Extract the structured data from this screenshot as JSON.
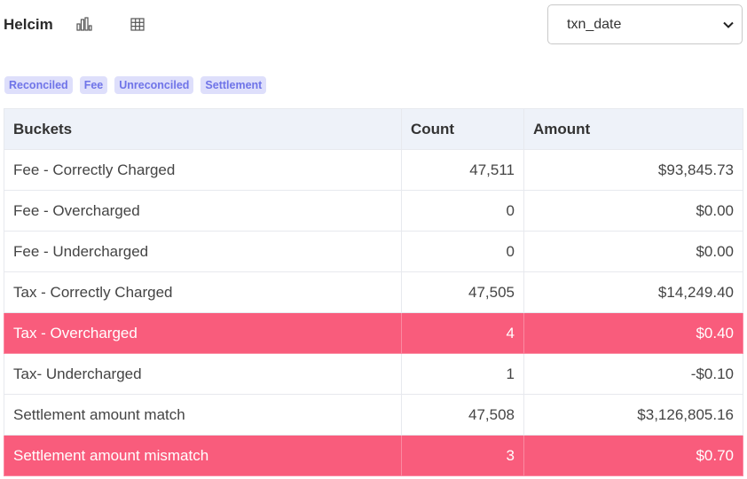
{
  "header": {
    "brand": "Helcim",
    "chart_icon": "bar-chart-icon",
    "table_icon": "table-grid-icon"
  },
  "date_select": {
    "value": "txn_date",
    "icon": "chevron-down-icon"
  },
  "tags": [
    {
      "label": "Reconciled"
    },
    {
      "label": "Fee"
    },
    {
      "label": "Unreconciled"
    },
    {
      "label": "Settlement"
    }
  ],
  "table": {
    "columns": [
      "Buckets",
      "Count",
      "Amount"
    ],
    "rows": [
      {
        "bucket": "Fee - Correctly Charged",
        "count": "47,511",
        "amount": "$93,845.73",
        "highlight": false
      },
      {
        "bucket": "Fee - Overcharged",
        "count": "0",
        "amount": "$0.00",
        "highlight": false
      },
      {
        "bucket": "Fee - Undercharged",
        "count": "0",
        "amount": "$0.00",
        "highlight": false
      },
      {
        "bucket": "Tax - Correctly Charged",
        "count": "47,505",
        "amount": "$14,249.40",
        "highlight": false
      },
      {
        "bucket": "Tax - Overcharged",
        "count": "4",
        "amount": "$0.40",
        "highlight": true
      },
      {
        "bucket": "Tax- Undercharged",
        "count": "1",
        "amount": "-$0.10",
        "highlight": false
      },
      {
        "bucket": "Settlement amount match",
        "count": "47,508",
        "amount": "$3,126,805.16",
        "highlight": false
      },
      {
        "bucket": "Settlement amount mismatch",
        "count": "3",
        "amount": "$0.70",
        "highlight": true
      }
    ]
  },
  "colors": {
    "highlight_row": "#f95c7c",
    "tag_bg": "#dedffb",
    "tag_text": "#6f74e8",
    "header_bg": "#eef2f9"
  }
}
